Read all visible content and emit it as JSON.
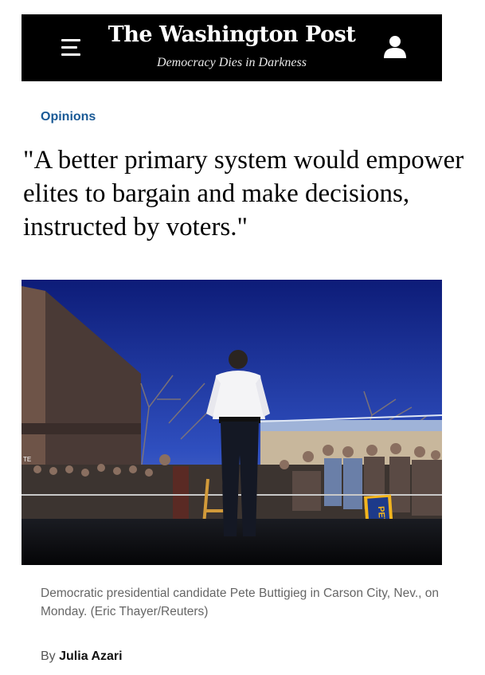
{
  "header": {
    "masthead": "The Washington Post",
    "tagline": "Democracy Dies in Darkness",
    "menu_icon": "hamburger-menu-icon",
    "user_icon": "user-account-icon"
  },
  "article": {
    "section": "Opinions",
    "pull_quote": "\"A better primary system would empower elites to bargain and make decisions, instructed by voters.\"",
    "photo": {
      "sign_text": "PETE",
      "corner_text": "TE"
    },
    "caption": "Democratic presidential candidate Pete Buttigieg in Carson City, Nev., on Monday. (Eric Thayer/Reuters)",
    "byline_prefix": "By",
    "author": "Julia Azari"
  },
  "colors": {
    "header_bg": "#000000",
    "section": "#1a5a96",
    "caption": "#666666",
    "sky": "#1f3aa8"
  }
}
